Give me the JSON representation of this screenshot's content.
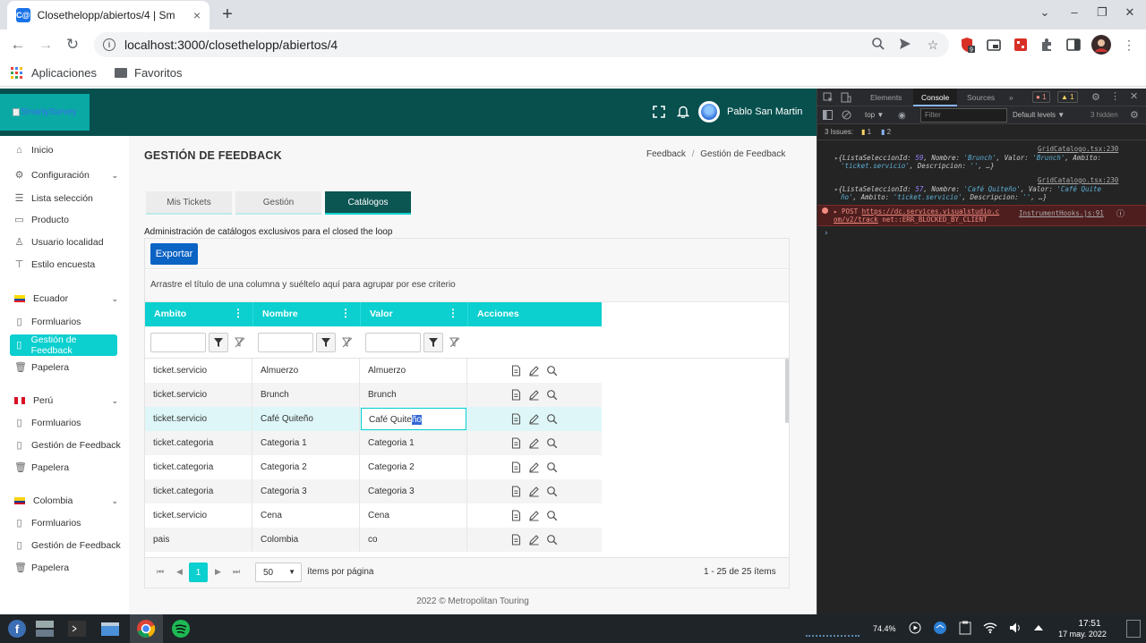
{
  "browser": {
    "tab_title": "Closethelopp/abiertos/4 | Sm",
    "favicon_text": "C@",
    "url": "localhost:3000/closethelopp/abiertos/4",
    "bookmarks": [
      "Aplicaciones",
      "Favoritos"
    ],
    "new_tab": "+",
    "close_tab": "×"
  },
  "app": {
    "logo_alt": "SmartySurvey",
    "user_name": "Pablo San Martin"
  },
  "sidebar": {
    "items": [
      {
        "label": "Inicio",
        "icon": "home-icon"
      },
      {
        "label": "Configuración",
        "icon": "gear-icon",
        "expandable": true
      },
      {
        "label": "Lista selección",
        "icon": "list-icon"
      },
      {
        "label": "Producto",
        "icon": "briefcase-icon"
      },
      {
        "label": "Usuario localidad",
        "icon": "user-icon"
      },
      {
        "label": "Estilo encuesta",
        "icon": "paint-roller-icon"
      }
    ],
    "countries": [
      {
        "name": "Ecuador",
        "items": [
          "Formluarios",
          "Gestión de Feedback",
          "Papelera"
        ],
        "active_item": "Gestión de Feedback"
      },
      {
        "name": "Perú",
        "items": [
          "Formluarios",
          "Gestión de Feedback",
          "Papelera"
        ]
      },
      {
        "name": "Colombia",
        "items": [
          "Formluarios",
          "Gestión de Feedback",
          "Papelera"
        ]
      }
    ]
  },
  "page": {
    "title": "GESTIÓN DE FEEDBACK",
    "breadcrumb": [
      "Feedback",
      "Gestión de Feedback"
    ],
    "breadcrumb_sep": "/",
    "tabs": [
      "Mis Tickets",
      "Gestión",
      "Catálogos"
    ],
    "active_tab": "Catálogos",
    "description": "Administración de catálogos exclusivos para el closed the loop",
    "export_label": "Exportar",
    "group_hint": "Arrastre el título de una columna y suéltelo aquí para agrupar por ese criterio"
  },
  "grid": {
    "columns": [
      "Ambito",
      "Nombre",
      "Valor",
      "Acciones"
    ],
    "rows": [
      [
        "ticket.servicio",
        "Almuerzo",
        "Almuerzo"
      ],
      [
        "ticket.servicio",
        "Brunch",
        "Brunch"
      ],
      [
        "ticket.servicio",
        "Café Quiteño",
        "Café Quiteño"
      ],
      [
        "ticket.categoria",
        "Categoria 1",
        "Categoria 1"
      ],
      [
        "ticket.categoria",
        "Categoria 2",
        "Categoria 2"
      ],
      [
        "ticket.categoria",
        "Categoria 3",
        "Categoria 3"
      ],
      [
        "ticket.servicio",
        "Cena",
        "Cena"
      ],
      [
        "pais",
        "Colombia",
        "co"
      ]
    ],
    "editing_row": 2,
    "edit_value_prefix": "Café Quite",
    "edit_value_selected": "ño",
    "pager": {
      "first": "⏮",
      "prev": "◀",
      "current_page": "1",
      "next": "▶",
      "last": "⏭",
      "page_size": "50",
      "per_page_label": "ítems por página",
      "range": "1 - 25 de 25 ítems"
    }
  },
  "footer": "2022 © Metropolitan Touring",
  "devtools": {
    "tabs": [
      "Elements",
      "Console",
      "Sources",
      "»"
    ],
    "active_tab": "Console",
    "error_count": "1",
    "warning_count": "1",
    "context": "top ▼",
    "filter_placeholder": "Filter",
    "levels": "Default levels ▼",
    "hidden": "3 hidden",
    "issues_label": "3 Issues:",
    "issues_warn": "1",
    "issues_info": "2",
    "logs": [
      {
        "source": "GridCatalogo.tsx:230",
        "line1": [
          "{ListaSeleccionId: ",
          "59",
          ", Nombre: ",
          "'Brunch'",
          ", Valor: ",
          "'Brunch'",
          ", Ambito:"
        ],
        "line2": [
          "'ticket.servicio'",
          ", Descripcion: ",
          "''",
          ", …}"
        ]
      },
      {
        "source": "GridCatalogo.tsx:230",
        "line1": [
          "{ListaSeleccionId: ",
          "57",
          ", Nombre: ",
          "'Café Quiteño'",
          ", Valor: ",
          "'Café Quite"
        ],
        "line2": [
          "ño'",
          ", Ambito: ",
          "'ticket.servicio'",
          ", Descripcion: ",
          "''",
          ", …}"
        ]
      }
    ],
    "error": {
      "method": "▸ POST",
      "url1": "https://dc.services.visualstudio.c",
      "url2": "om/v2/track",
      "message": "net::ERR_BLOCKED_BY_CLIENT",
      "source": "InstrumentHooks.js:91"
    },
    "prompt": "›"
  },
  "taskbar": {
    "battery": "74.4%",
    "time": "17:51",
    "date": "17 may. 2022"
  },
  "colors": {
    "teal_header": "#07504e",
    "accent_cyan": "#0ccfcf",
    "export_blue": "#0b63c4"
  }
}
